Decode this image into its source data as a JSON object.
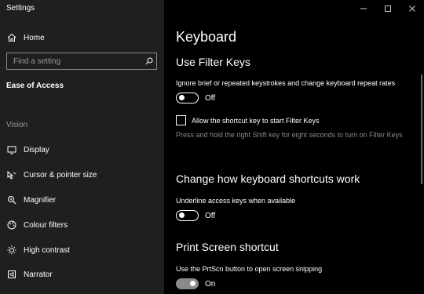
{
  "window": {
    "title": "Settings",
    "controls": [
      "minimize",
      "maximize",
      "close"
    ]
  },
  "sidebar": {
    "home_label": "Home",
    "search_placeholder": "Find a setting",
    "section_heading": "Ease of Access",
    "group_label": "Vision",
    "items": [
      {
        "label": "Display",
        "icon": "display-icon"
      },
      {
        "label": "Cursor & pointer size",
        "icon": "cursor-icon"
      },
      {
        "label": "Magnifier",
        "icon": "magnifier-icon"
      },
      {
        "label": "Colour filters",
        "icon": "colour-filters-icon"
      },
      {
        "label": "High contrast",
        "icon": "high-contrast-icon"
      },
      {
        "label": "Narrator",
        "icon": "narrator-icon"
      }
    ]
  },
  "main": {
    "page_title": "Keyboard",
    "filter_keys": {
      "heading": "Use Filter Keys",
      "description": "Ignore brief or repeated keystrokes and change keyboard repeat rates",
      "toggle_state": "Off",
      "checkbox_label": "Allow the shortcut key to start Filter Keys",
      "hint": "Press and hold the right Shift key for eight seconds to turn on Filter Keys"
    },
    "shortcuts": {
      "heading": "Change how keyboard shortcuts work",
      "description": "Underline access keys when available",
      "toggle_state": "Off"
    },
    "print_screen": {
      "heading": "Print Screen shortcut",
      "description": "Use the PrtScn button to open screen snipping",
      "toggle_state": "On"
    }
  },
  "colors": {
    "sidebar_bg": "#1f1f1f",
    "content_bg": "#000000",
    "muted_text": "#8a8a8a",
    "toggle_on_track": "#8a8a8a"
  }
}
